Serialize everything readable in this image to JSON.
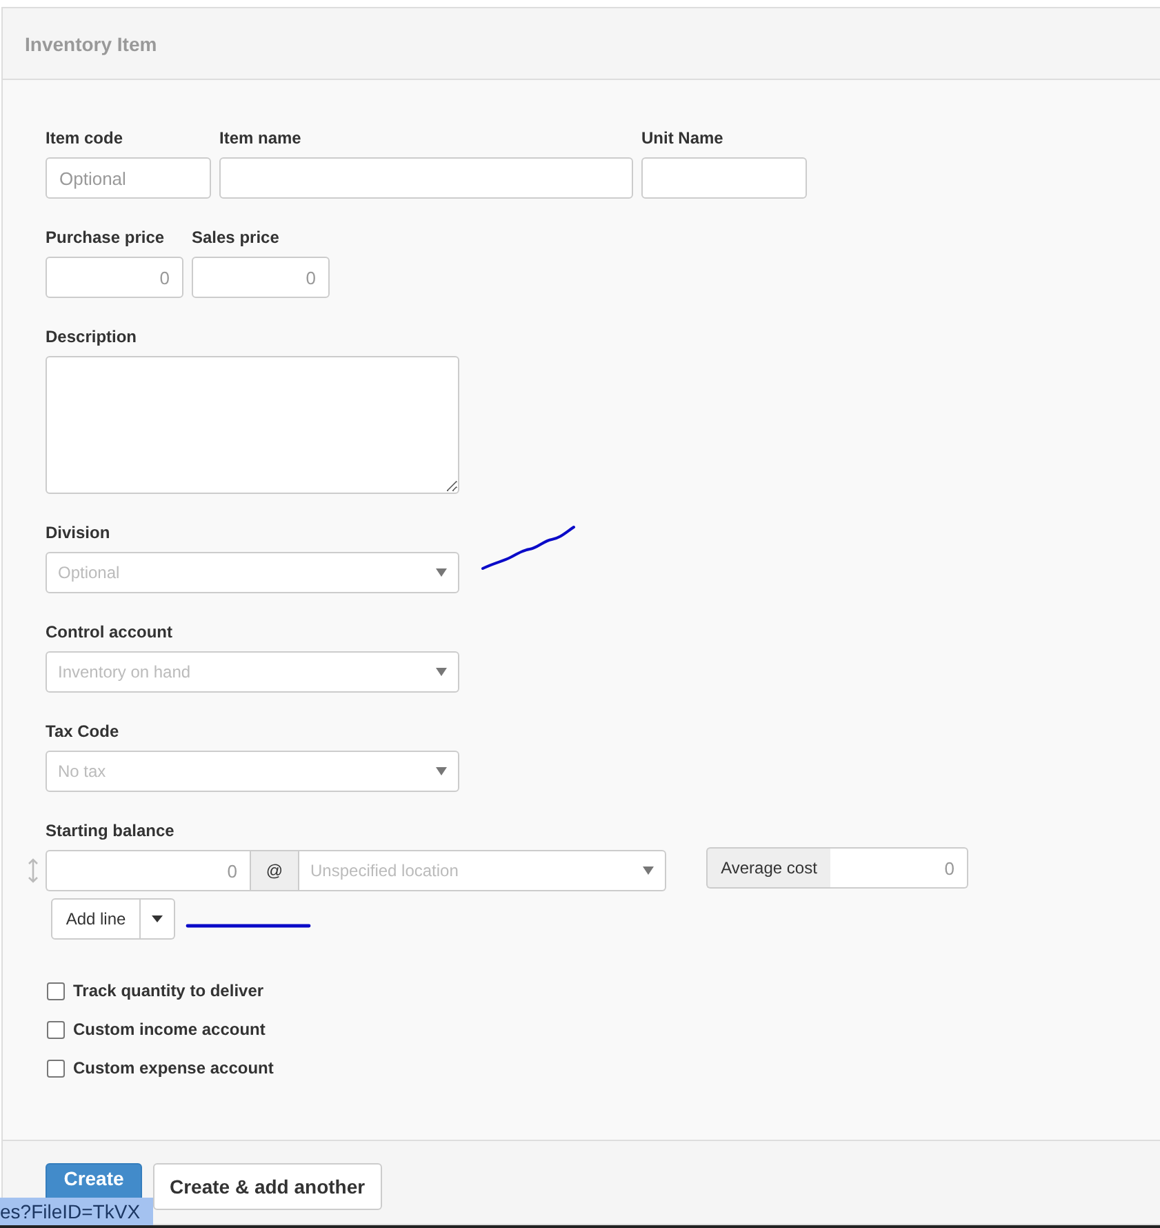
{
  "panel": {
    "title": "Inventory Item"
  },
  "item_row": [
    {
      "label": "Item code",
      "placeholder": "Optional"
    },
    {
      "label": "Item name"
    },
    {
      "label": "Unit Name"
    }
  ],
  "price_row": [
    {
      "label": "Purchase price",
      "placeholder": "0"
    },
    {
      "label": "Sales price",
      "placeholder": "0"
    }
  ],
  "description": {
    "label": "Description"
  },
  "selects": [
    {
      "label": "Division",
      "placeholder": "Optional"
    },
    {
      "label": "Control account",
      "placeholder": "Inventory on hand"
    },
    {
      "label": "Tax Code",
      "placeholder": "No tax"
    }
  ],
  "starting_balance": {
    "label": "Starting balance",
    "quantity_placeholder": "0",
    "at_symbol": "@",
    "location_placeholder": "Unspecified location",
    "average_cost_label": "Average cost",
    "average_cost_placeholder": "0",
    "add_line_button": "Add line"
  },
  "options": [
    {
      "label": "Track quantity to deliver",
      "checked": false
    },
    {
      "label": "Custom income account",
      "checked": false
    },
    {
      "label": "Custom expense account",
      "checked": false
    }
  ],
  "buttons": [
    {
      "label": "Create",
      "kind": "primary"
    },
    {
      "label": "Create & add another",
      "kind": "default"
    }
  ],
  "status_url": "es?FileID=TkVX"
}
